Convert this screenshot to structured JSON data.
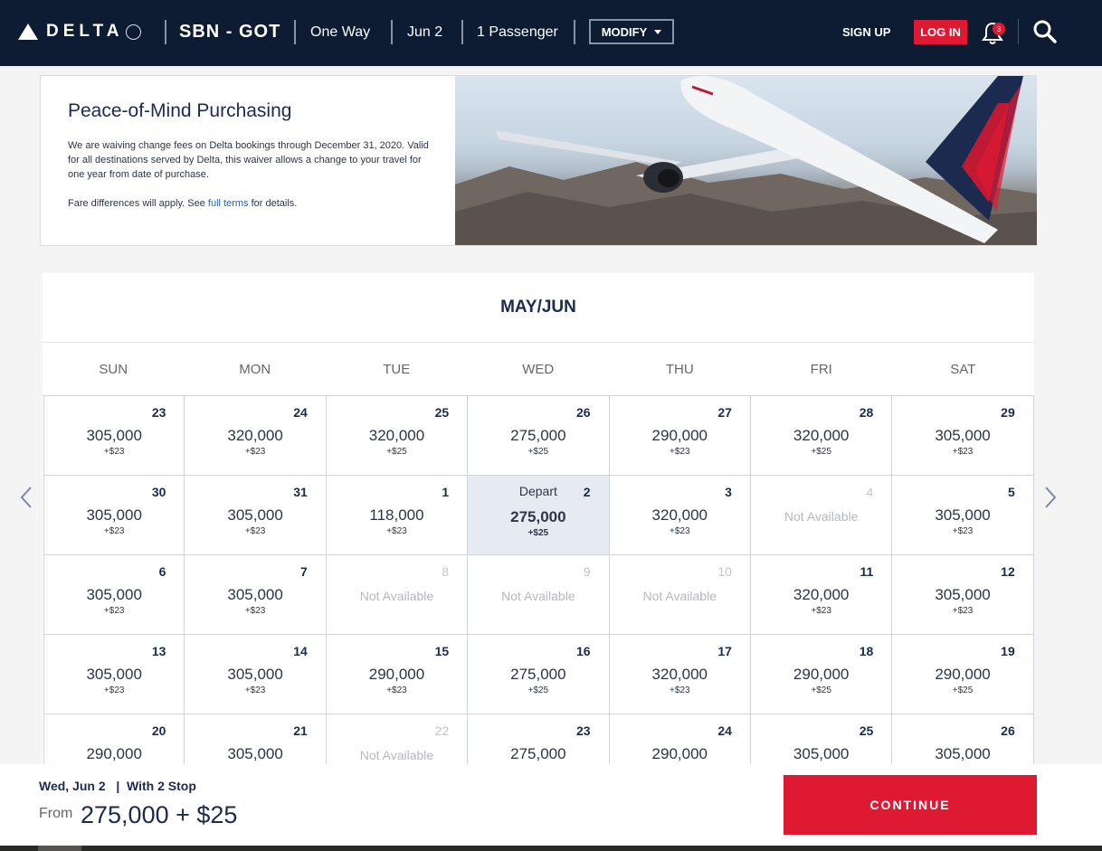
{
  "header": {
    "logo_text": "DELTA",
    "route": "SBN - GOT",
    "trip_type": "One Way",
    "date": "Jun 2",
    "passengers": "1 Passenger",
    "modify_label": "MODIFY",
    "signup_label": "SIGN UP",
    "login_label": "LOG IN",
    "notification_count": "3",
    "colors": {
      "navy": "#0d1b33",
      "red": "#e01933"
    }
  },
  "promo": {
    "title": "Peace-of-Mind Purchasing",
    "body": "We are waiving change fees on Delta bookings through December 31, 2020. Valid for all destinations served by Delta, this waiver allows a change to your travel for one year from date of purchase.",
    "note_before": "Fare differences will apply. See ",
    "note_link": "full terms",
    "note_after": " for details."
  },
  "calendar": {
    "title": "MAY/JUN",
    "weekdays": [
      "SUN",
      "MON",
      "TUE",
      "WED",
      "THU",
      "FRI",
      "SAT"
    ],
    "depart_label": "Depart",
    "not_available_label": "Not Available",
    "days": [
      {
        "day": "23",
        "miles": "305,000",
        "tax": "+$23"
      },
      {
        "day": "24",
        "miles": "320,000",
        "tax": "+$23"
      },
      {
        "day": "25",
        "miles": "320,000",
        "tax": "+$25"
      },
      {
        "day": "26",
        "miles": "275,000",
        "tax": "+$25"
      },
      {
        "day": "27",
        "miles": "290,000",
        "tax": "+$23"
      },
      {
        "day": "28",
        "miles": "320,000",
        "tax": "+$25"
      },
      {
        "day": "29",
        "miles": "305,000",
        "tax": "+$23"
      },
      {
        "day": "30",
        "miles": "305,000",
        "tax": "+$23"
      },
      {
        "day": "31",
        "miles": "305,000",
        "tax": "+$23"
      },
      {
        "day": "1",
        "miles": "118,000",
        "tax": "+$23"
      },
      {
        "day": "2",
        "miles": "275,000",
        "tax": "+$25",
        "selected": true
      },
      {
        "day": "3",
        "miles": "320,000",
        "tax": "+$23"
      },
      {
        "day": "4",
        "na": true
      },
      {
        "day": "5",
        "miles": "305,000",
        "tax": "+$23"
      },
      {
        "day": "6",
        "miles": "305,000",
        "tax": "+$23"
      },
      {
        "day": "7",
        "miles": "305,000",
        "tax": "+$23"
      },
      {
        "day": "8",
        "na": true
      },
      {
        "day": "9",
        "na": true
      },
      {
        "day": "10",
        "na": true
      },
      {
        "day": "11",
        "miles": "320,000",
        "tax": "+$23"
      },
      {
        "day": "12",
        "miles": "305,000",
        "tax": "+$23"
      },
      {
        "day": "13",
        "miles": "305,000",
        "tax": "+$23"
      },
      {
        "day": "14",
        "miles": "305,000",
        "tax": "+$23"
      },
      {
        "day": "15",
        "miles": "290,000",
        "tax": "+$23"
      },
      {
        "day": "16",
        "miles": "275,000",
        "tax": "+$25"
      },
      {
        "day": "17",
        "miles": "320,000",
        "tax": "+$23"
      },
      {
        "day": "18",
        "miles": "290,000",
        "tax": "+$25"
      },
      {
        "day": "19",
        "miles": "290,000",
        "tax": "+$25"
      },
      {
        "day": "20",
        "miles": "290,000"
      },
      {
        "day": "21",
        "miles": "305,000"
      },
      {
        "day": "22",
        "na": true
      },
      {
        "day": "23",
        "miles": "275,000"
      },
      {
        "day": "24",
        "miles": "290,000"
      },
      {
        "day": "25",
        "miles": "305,000"
      },
      {
        "day": "26",
        "miles": "305,000"
      }
    ]
  },
  "summary": {
    "line": "Wed, Jun 2   |  With 2 Stop",
    "from_label": "From",
    "price": "275,000 + $25",
    "continue_label": "CONTINUE"
  }
}
